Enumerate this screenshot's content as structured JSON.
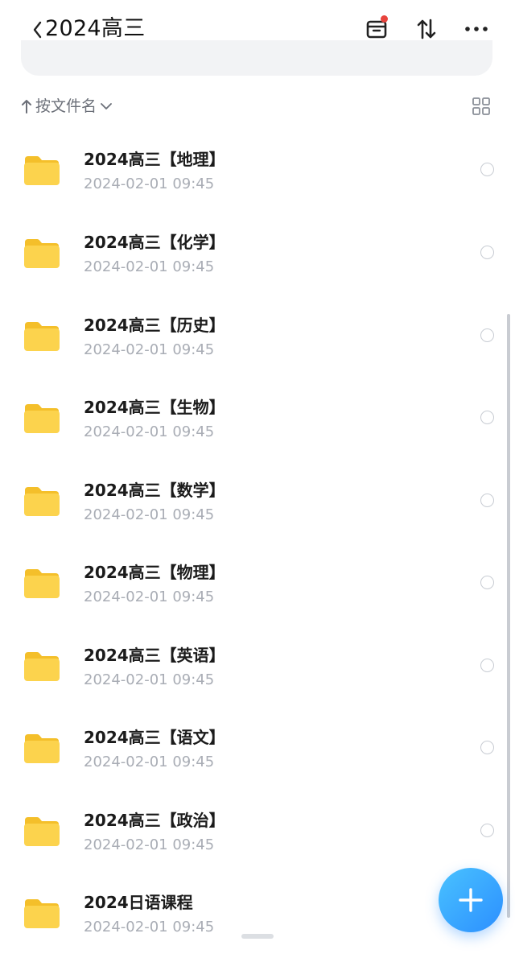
{
  "header": {
    "title": "2024高三",
    "icons": [
      "back-icon",
      "archive-icon",
      "sort-arrows-icon",
      "more-icon"
    ],
    "notification_dot_color": "#e8443d"
  },
  "sort": {
    "label": "按文件名",
    "icons": [
      "sort-up-arrow-icon",
      "chevron-down-icon",
      "grid-view-icon"
    ]
  },
  "files": [
    {
      "name": "2024高三【地理】",
      "date": "2024-02-01 09:45"
    },
    {
      "name": "2024高三【化学】",
      "date": "2024-02-01 09:45"
    },
    {
      "name": "2024高三【历史】",
      "date": "2024-02-01 09:45"
    },
    {
      "name": "2024高三【生物】",
      "date": "2024-02-01 09:45"
    },
    {
      "name": "2024高三【数学】",
      "date": "2024-02-01 09:45"
    },
    {
      "name": "2024高三【物理】",
      "date": "2024-02-01 09:45"
    },
    {
      "name": "2024高三【英语】",
      "date": "2024-02-01 09:45"
    },
    {
      "name": "2024高三【语文】",
      "date": "2024-02-01 09:45"
    },
    {
      "name": "2024高三【政治】",
      "date": "2024-02-01 09:45"
    },
    {
      "name": "2024日语课程",
      "date": "2024-02-01 09:45"
    }
  ],
  "fab": {
    "icon": "plus-icon",
    "color": "#2c8fff"
  },
  "colors": {
    "folder": "#fcd34d",
    "accent": "#2c8fff"
  }
}
